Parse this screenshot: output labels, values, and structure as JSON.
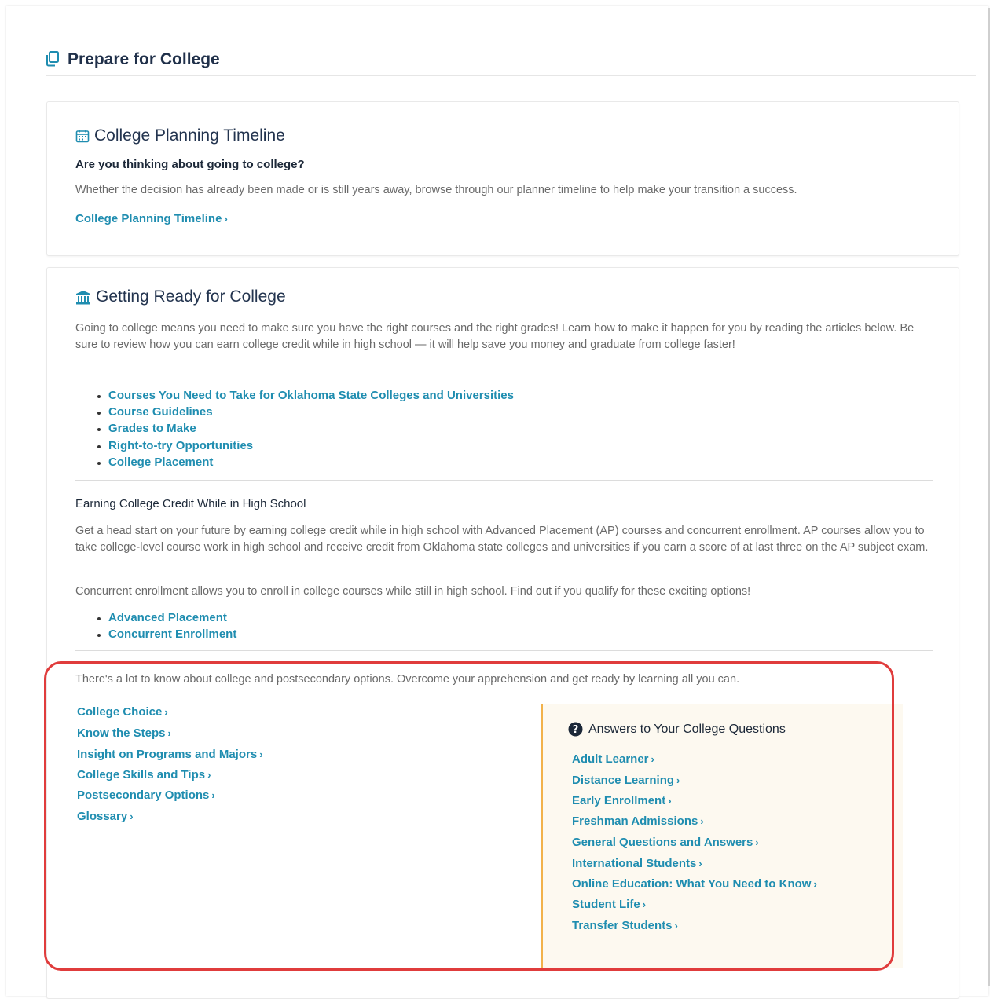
{
  "page": {
    "title": "Prepare for College"
  },
  "timeline_card": {
    "title": "College Planning Timeline",
    "question": "Are you thinking about going to college?",
    "description": "Whether the decision has already been made or is still years away, browse through our planner timeline to help make your transition a success.",
    "link_label": "College Planning Timeline"
  },
  "ready_card": {
    "title": "Getting Ready for College",
    "intro": "Going to college means you need to make sure you have the right courses and the right grades! Learn how to make it happen for you by reading the articles below. Be sure to review how you can earn college credit while in high school — it will help save you money and graduate from college faster!",
    "article_links": [
      "Courses You Need to Take for Oklahoma State Colleges and Universities",
      "Course Guidelines",
      "Grades to Make",
      "Right-to-try Opportunities",
      "College Placement"
    ],
    "credit_heading": "Earning College Credit While in High School",
    "credit_text": "Get a head start on your future by earning college credit while in high school with Advanced Placement (AP) courses and concurrent enrollment. AP courses allow you to take college-level course work in high school and receive credit from Oklahoma state colleges and universities if you earn a score of at last three on the AP subject exam.",
    "concurrent_text": "Concurrent enrollment allows you to enroll in college courses while still in high school. Find out if you qualify for these exciting options!",
    "credit_links": [
      "Advanced Placement",
      "Concurrent Enrollment"
    ],
    "lead_text": "There's a lot to know about college and postsecondary options. Overcome your apprehension and get ready by learning all you can.",
    "topic_links": [
      "College Choice",
      "Know the Steps",
      "Insight on Programs and Majors",
      "College Skills and Tips",
      "Postsecondary Options",
      "Glossary"
    ],
    "faq": {
      "title": "Answers to Your College Questions",
      "links": [
        "Adult Learner",
        "Distance Learning",
        "Early Enrollment",
        "Freshman Admissions",
        "General Questions and Answers",
        "International Students",
        "Online Education: What You Need to Know",
        "Student Life",
        "Transfer Students"
      ]
    }
  },
  "colors": {
    "link": "#1f8db0",
    "heading": "#20304a",
    "accent": "#f2b24b",
    "highlight": "#e03c3c"
  },
  "icons": [
    "copy-icon",
    "calendar-icon",
    "institution-icon",
    "question-circle-icon",
    "chevron-right-icon"
  ]
}
